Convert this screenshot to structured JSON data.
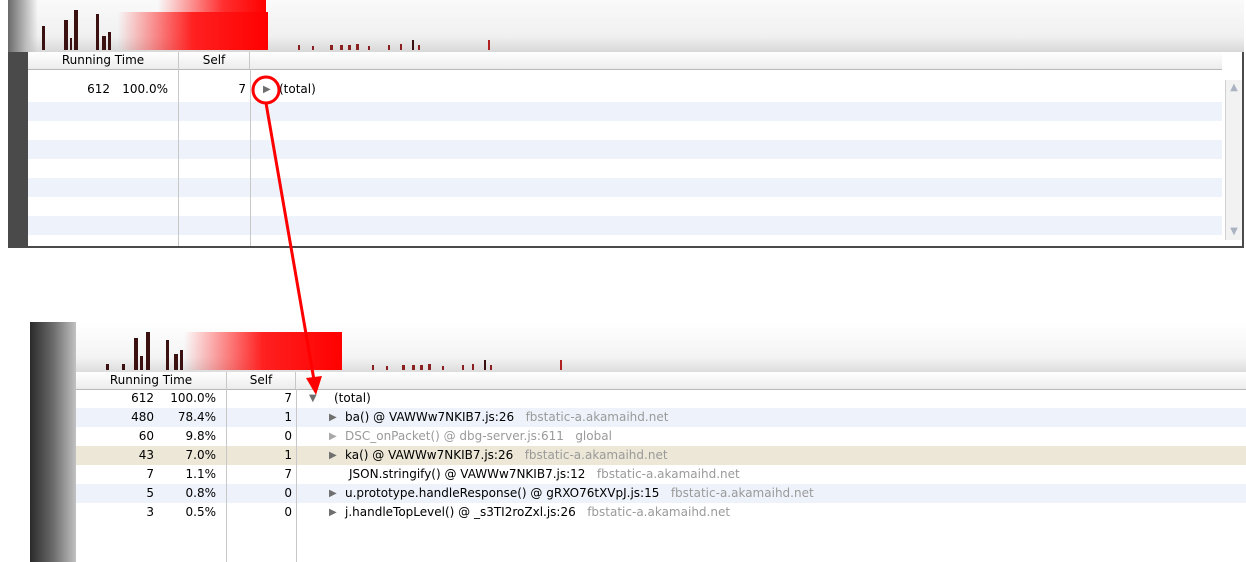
{
  "columns": {
    "running_time": "Running Time",
    "self": "Self"
  },
  "top": {
    "rows": [
      {
        "count": "612",
        "pct": "100.0%",
        "self": "7",
        "name": "(total)"
      }
    ]
  },
  "bottom": {
    "rows": [
      {
        "count": "612",
        "pct": "100.0%",
        "self": "7",
        "name": "(total)",
        "host": "",
        "expanded": true,
        "dim": false
      },
      {
        "count": "480",
        "pct": "78.4%",
        "self": "1",
        "name": "ba() @ VAWWw7NKIB7.js:26",
        "host": "fbstatic-a.akamaihd.net",
        "expanded": false,
        "dim": false
      },
      {
        "count": "60",
        "pct": "9.8%",
        "self": "0",
        "name": "DSC_onPacket() @ dbg-server.js:611",
        "host": "global",
        "expanded": false,
        "dim": true
      },
      {
        "count": "43",
        "pct": "7.0%",
        "self": "1",
        "name": "ka() @ VAWWw7NKIB7.js:26",
        "host": "fbstatic-a.akamaihd.net",
        "expanded": false,
        "dim": false,
        "selected": true
      },
      {
        "count": "7",
        "pct": "1.1%",
        "self": "7",
        "name": "JSON.stringify() @ VAWWw7NKIB7.js:12",
        "host": "fbstatic-a.akamaihd.net",
        "expanded": false,
        "dim": false,
        "leaf": true
      },
      {
        "count": "5",
        "pct": "0.8%",
        "self": "0",
        "name": "u.prototype.handleResponse() @ gRXO76tXVpJ.js:15",
        "host": "fbstatic-a.akamaihd.net",
        "expanded": false,
        "dim": false
      },
      {
        "count": "3",
        "pct": "0.5%",
        "self": "0",
        "name": "j.handleTopLevel() @ _s3TI2roZxl.js:26",
        "host": "fbstatic-a.akamaihd.net",
        "expanded": false,
        "dim": false
      }
    ]
  },
  "colors": {
    "annotation": "#ff0000",
    "selected_row": "#ece7d6",
    "stripe": "#eef3fb",
    "host_text": "#9a9a9a"
  },
  "icons": [
    "expand-triangle-icon",
    "collapse-triangle-icon",
    "scroll-up-icon",
    "scroll-down-icon"
  ]
}
